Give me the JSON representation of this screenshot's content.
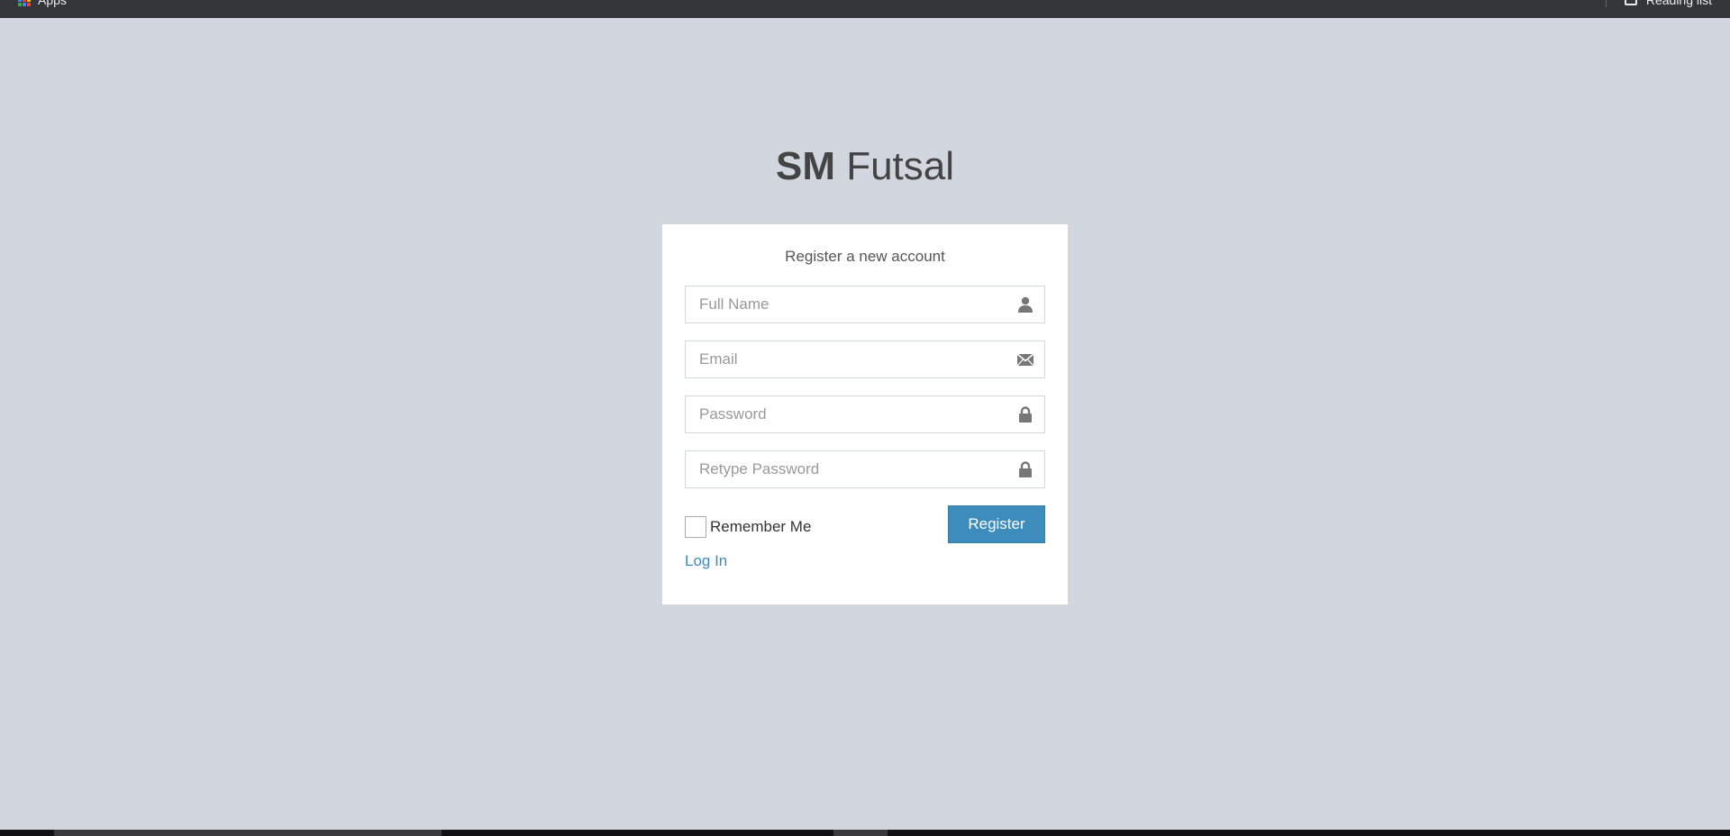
{
  "browser": {
    "bookmarks_bar": {
      "apps_label": "Apps",
      "reading_list_label": "Reading list"
    }
  },
  "logo": {
    "bold": "SM",
    "light": "Futsal"
  },
  "register": {
    "message": "Register a new account",
    "full_name": {
      "placeholder": "Full Name",
      "icon": "user-icon"
    },
    "email": {
      "placeholder": "Email",
      "icon": "envelope-icon"
    },
    "password": {
      "placeholder": "Password",
      "icon": "lock-icon"
    },
    "retype_password": {
      "placeholder": "Retype Password",
      "icon": "lock-icon"
    },
    "remember_label": "Remember Me",
    "submit_label": "Register",
    "login_link": "Log In"
  },
  "colors": {
    "page_background": "#d2d6de",
    "primary_button": "#3c8dbc",
    "link": "#3c8dbc",
    "icon": "#777777"
  }
}
